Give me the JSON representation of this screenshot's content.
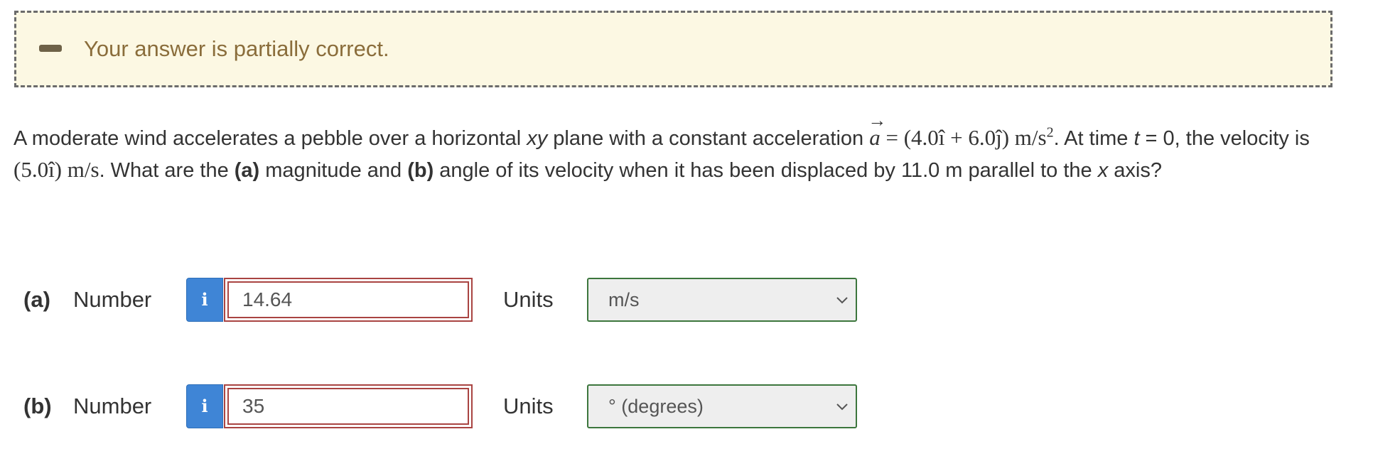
{
  "feedback": {
    "icon": "minus-icon",
    "message": "Your answer is partially correct.",
    "colors": {
      "background": "#fcf8e3",
      "text": "#8a6d3b",
      "border": "#6b6b6b"
    }
  },
  "question": {
    "t1": "A moderate wind accelerates a pebble over a horizontal ",
    "xy": "xy",
    "t2": " plane with a constant acceleration ",
    "a_vec": "a",
    "eq_accel": " = (4.0î + 6.0ĵ) m/s",
    "exp2": "2",
    "t3": ". At time ",
    "t_var": "t",
    "t4": " = 0, the velocity is ",
    "vel": "(5.0î) m/s",
    "t5": ". What are the ",
    "pa": "(a)",
    "t6": " magnitude and ",
    "pb": "(b)",
    "t7": " angle of its velocity when it has been displaced by 11.0 m parallel to the ",
    "x_var": "x",
    "t8": " axis?"
  },
  "answers": [
    {
      "part": "(a)",
      "number_label": "Number",
      "info_icon": "info-icon",
      "value": "14.64",
      "units_label": "Units",
      "unit": "m/s",
      "status": "incorrect"
    },
    {
      "part": "(b)",
      "number_label": "Number",
      "info_icon": "info-icon",
      "value": "35",
      "units_label": "Units",
      "unit": "° (degrees)",
      "status": "incorrect"
    }
  ],
  "colors": {
    "info_button": "#3f85d6",
    "incorrect_border": "#a94442",
    "unit_border": "#3c763d"
  }
}
